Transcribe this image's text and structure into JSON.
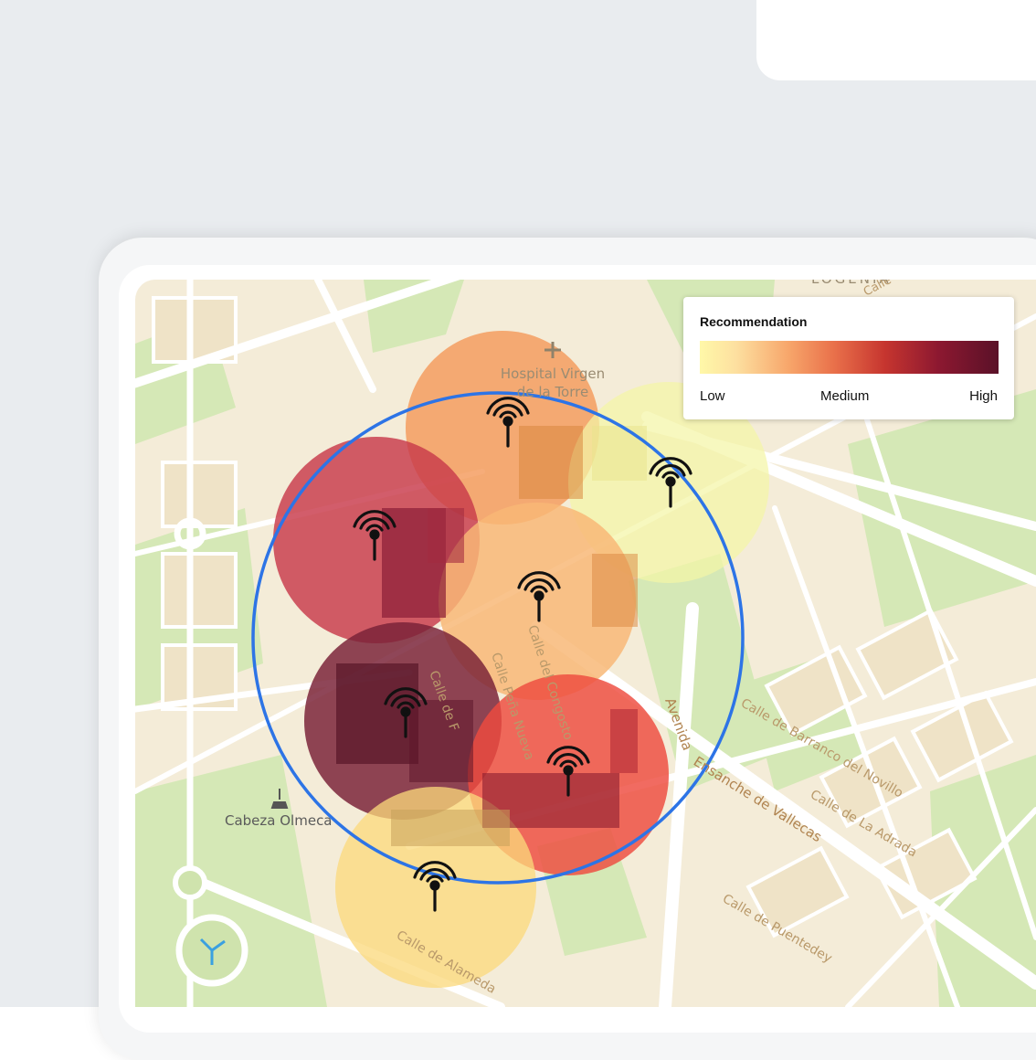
{
  "legend": {
    "title": "Recommendation",
    "low": "Low",
    "medium": "Medium",
    "high": "High",
    "gradient_colors": [
      "#fff8a8",
      "#f7a56a",
      "#e9704a",
      "#c6352f",
      "#8c1830",
      "#5a1128"
    ]
  },
  "map": {
    "labels": {
      "hospital_line1": "Hospital Virgen",
      "hospital_line2": "de la Torre",
      "district_top": "LOGENIA",
      "cabeza": "Cabeza Olmeca",
      "street_congosto": "Calle del Congosto",
      "street_pena_nueva": "Calle Peña Nueva",
      "street_de_f": "Calle de F",
      "street_alameda": "Calle de Alameda",
      "avenida_1": "Avenida",
      "avenida_2": "Ensanche de Vallecas",
      "street_barranco": "Calle de Barranco del Novillo",
      "street_adrada": "Calle de La Adrada",
      "street_puentedey": "Calle de Puentedey",
      "street_calle": "Calle"
    },
    "towers": [
      {
        "name": "tower-top-orange",
        "level": "medium-low",
        "color": "#f49a5c"
      },
      {
        "name": "tower-right-yellow",
        "level": "low",
        "color": "#f4f5a6"
      },
      {
        "name": "tower-left-red",
        "level": "high",
        "color": "#c8394a"
      },
      {
        "name": "tower-center-orange",
        "level": "medium-low",
        "color": "#f8b776"
      },
      {
        "name": "tower-lower-left-darkred",
        "level": "very-high",
        "color": "#7a2338"
      },
      {
        "name": "tower-lower-right-red",
        "level": "high",
        "color": "#ee4a3e"
      },
      {
        "name": "tower-bottom-yellow",
        "level": "low",
        "color": "#fbd97b"
      }
    ],
    "coverage_circle_color": "#2d74e6"
  }
}
